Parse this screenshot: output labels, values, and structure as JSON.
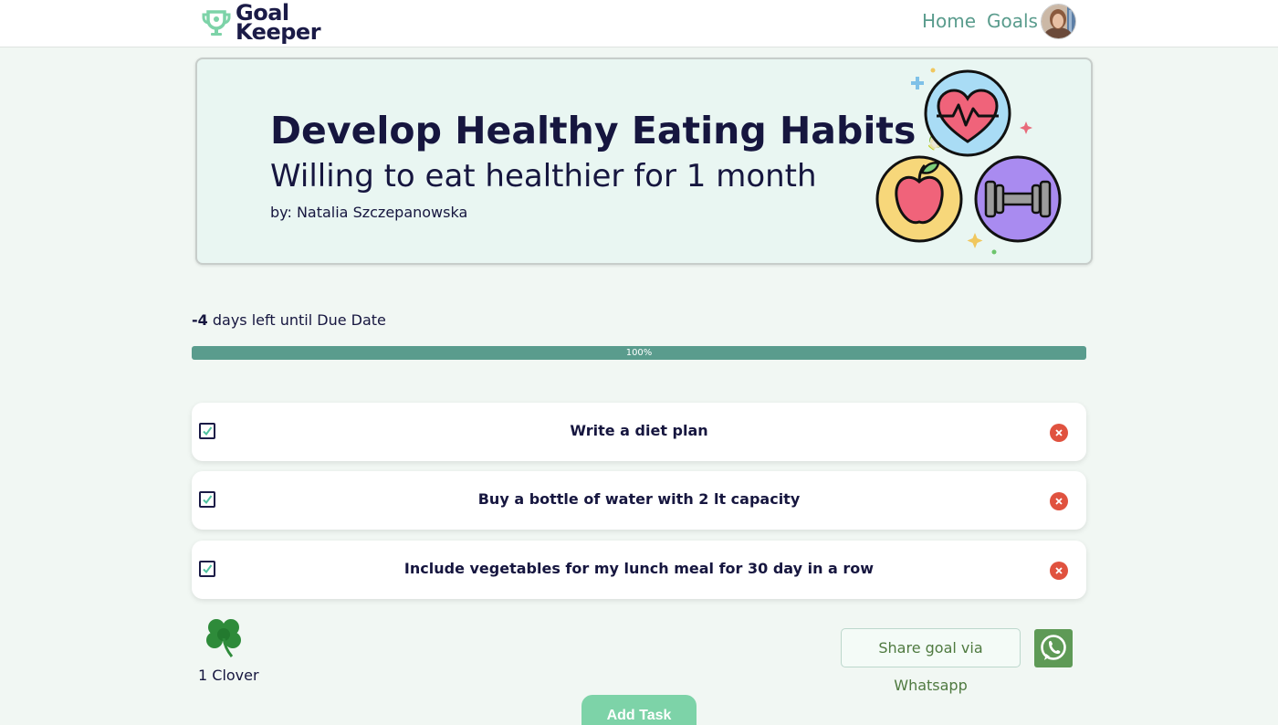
{
  "navbar": {
    "logo_line1": "Goal",
    "logo_line2": "Keeper",
    "home_label": "Home",
    "goals_label": "Goals"
  },
  "goal": {
    "title": "Develop Healthy Eating Habits",
    "title_emoji": "🥬",
    "subtitle": "Willing to eat healthier for 1 month",
    "author": "by: Natalia Szczepanowska"
  },
  "due": {
    "days_value": "-4",
    "days_text": " days left until Due Date"
  },
  "progress": {
    "percent": 100,
    "label": "100%"
  },
  "tasks": [
    {
      "label": "Write a diet plan",
      "checked": true
    },
    {
      "label": "Buy a bottle of water with 2 lt capacity",
      "checked": true
    },
    {
      "label": "Include vegetables for my lunch meal for 30 day in a row",
      "checked": true
    }
  ],
  "rewards": {
    "clover_label": "1 Clover"
  },
  "share": {
    "label": "Share goal via Whatsapp"
  },
  "add_task": {
    "label": "Add Task"
  },
  "colors": {
    "accent": "#5a9c8d",
    "navy": "#16163f",
    "hero_bg": "#e9f6f2",
    "delete": "#e0523f",
    "add_button": "#7dd3a8",
    "whatsapp": "#5e9a56"
  }
}
